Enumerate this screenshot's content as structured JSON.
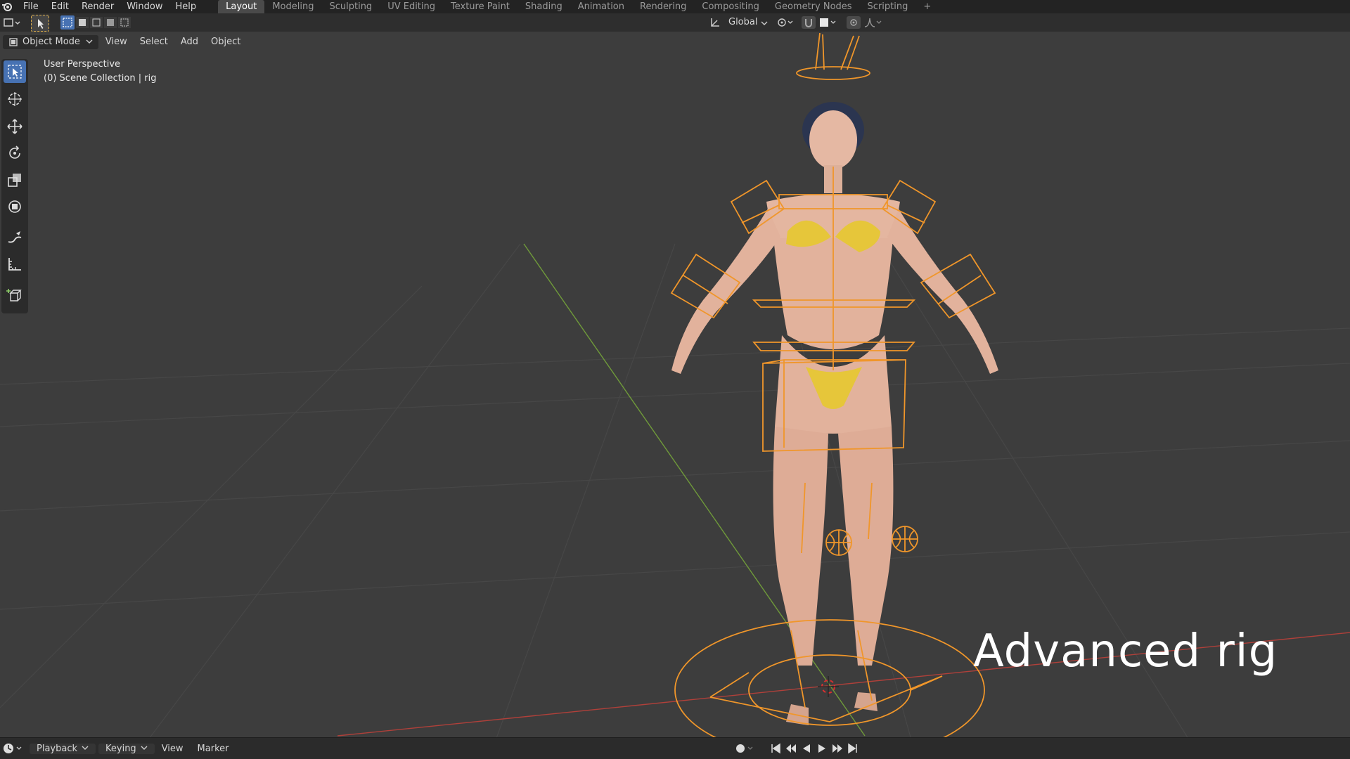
{
  "menu": [
    "File",
    "Edit",
    "Render",
    "Window",
    "Help"
  ],
  "workspaces": [
    "Layout",
    "Modeling",
    "Sculpting",
    "UV Editing",
    "Texture Paint",
    "Shading",
    "Animation",
    "Rendering",
    "Compositing",
    "Geometry Nodes",
    "Scripting"
  ],
  "add_workspace": "+",
  "header": {
    "mode": "Object Mode",
    "view": "View",
    "select": "Select",
    "add": "Add",
    "object": "Object",
    "transform_orientation": "Global"
  },
  "viewport": {
    "perspective": "User Perspective",
    "collection": "(0) Scene Collection | rig",
    "caption": "Advanced rig"
  },
  "timeline": {
    "playback": "Playback",
    "keying": "Keying",
    "view": "View",
    "marker": "Marker"
  },
  "colors": {
    "accent": "#4772b3",
    "rig": "#f0962a",
    "x_axis": "#b0403a",
    "y_axis": "#6f9a3a"
  }
}
